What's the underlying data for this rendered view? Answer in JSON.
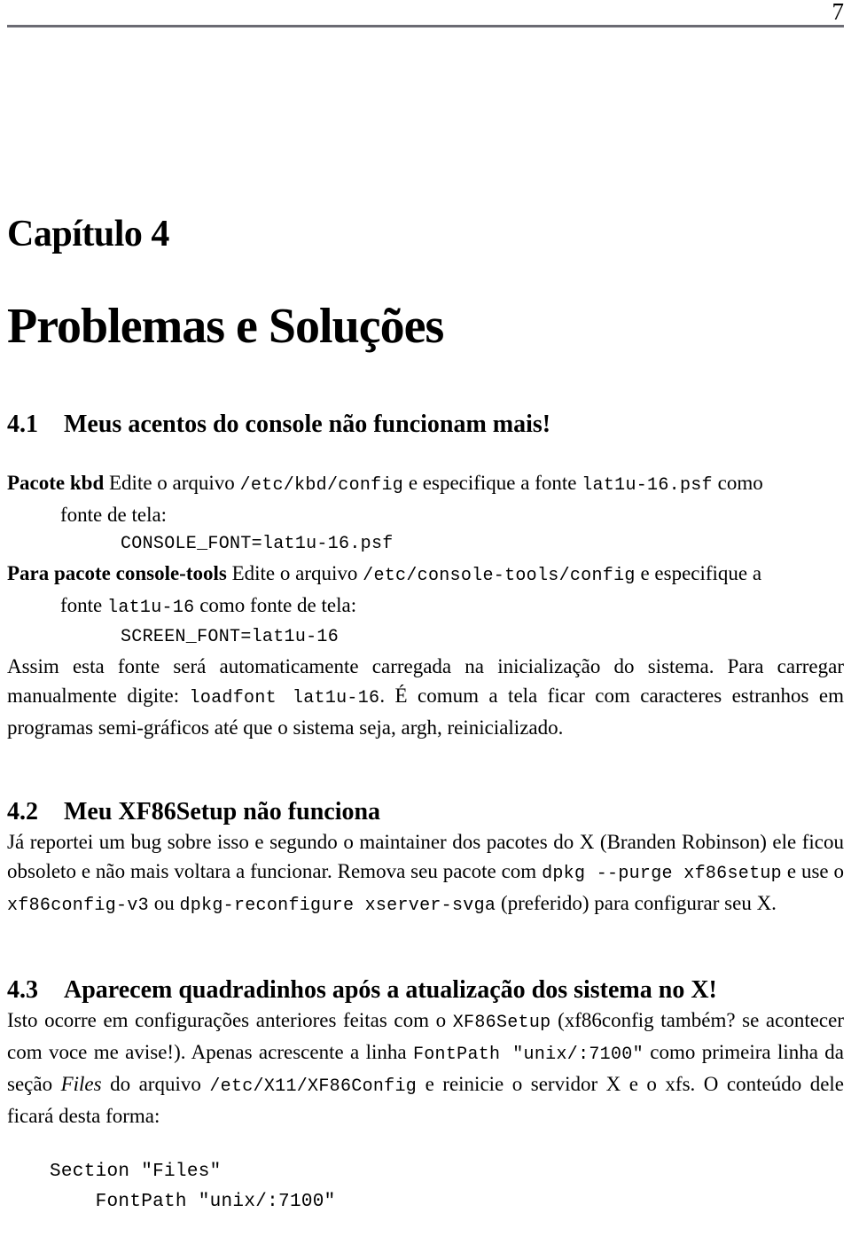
{
  "page": {
    "folio": "7",
    "background_color": "#ffffff",
    "text_color": "#000000",
    "rule_color": "#6b6b73"
  },
  "chapter": {
    "label": "Capítulo 4",
    "title": "Problemas e Soluções"
  },
  "sections": [
    {
      "number": "4.1",
      "title": "Meus acentos do console não funcionam mais!"
    },
    {
      "number": "4.2",
      "title": "Meu XF86Setup não funciona"
    },
    {
      "number": "4.3",
      "title": "Aparecem quadradinhos após a atualização dos sistema no X!"
    }
  ],
  "s41": {
    "item1_term": "Pacote kbd",
    "item1_text_a": "Edite o arquivo",
    "item1_code_a": "/etc/kbd/config",
    "item1_text_b": "e especifique a fonte",
    "item1_code_b": "lat1u-16.psf",
    "item1_text_c": "como",
    "item1_line2": "fonte de tela:",
    "item1_code_line": "CONSOLE_FONT=lat1u-16.psf",
    "item2_term": "Para pacote console-tools",
    "item2_text_a": "Edite o arquivo",
    "item2_code_a": "/etc/console-tools/config",
    "item2_text_b": "e especifique a",
    "item2_line2_a": "fonte",
    "item2_line2_code": "lat1u-16",
    "item2_line2_b": "como fonte de tela:",
    "item2_code_line": "SCREEN_FONT=lat1u-16",
    "para_a": "Assim esta fonte será automaticamente carregada na inicialização do sistema. Para carregar manualmente digite:",
    "para_code": "loadfont lat1u-16",
    "para_b": ". É comum a tela ficar com caracteres estranhos em programas semi-gráficos até que o sistema seja, argh, reinicializado."
  },
  "s42": {
    "para_a": "Já reportei um bug sobre isso e segundo o maintainer dos pacotes do X (Branden Robinson) ele ficou obsoleto e não mais voltara a funcionar. Remova seu pacote com",
    "code_a": "dpkg --purge xf86setup",
    "para_b": "e use o",
    "code_b": "xf86config-v3",
    "para_c": "ou",
    "code_c": "dpkg-reconfigure xserver-svga",
    "para_d": "(preferido) para configurar seu X."
  },
  "s43": {
    "para_a": "Isto ocorre em configurações anteriores feitas com o",
    "code_a": "XF86Setup",
    "para_b": "(xf86config também? se acontecer com voce me avise!). Apenas acrescente a linha",
    "code_b": "FontPath \"unix/:7100\"",
    "para_c": "como primeira linha da seção",
    "emph_a": "Files",
    "para_d": "do arquivo",
    "code_c": "/etc/X11/XF86Config",
    "para_e": "e reinicie o servidor X e o xfs. O conteúdo dele ficará desta forma:",
    "code_block": "Section \"Files\"\n    FontPath \"unix/:7100\""
  }
}
